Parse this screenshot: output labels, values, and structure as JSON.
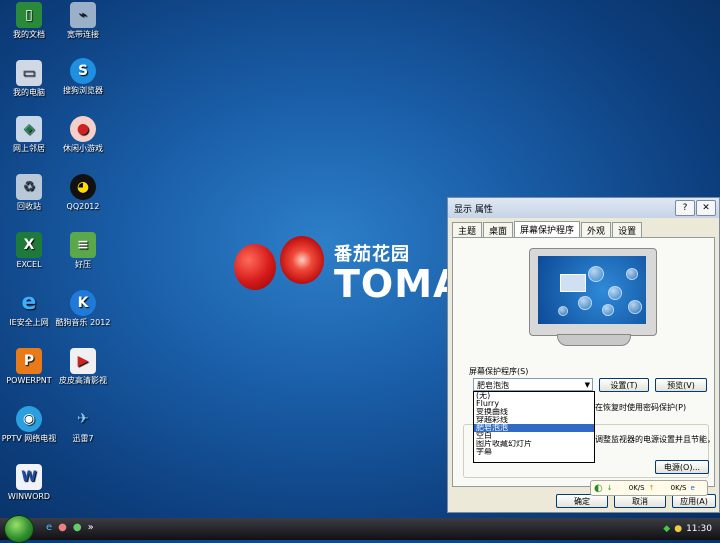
{
  "desktop": {
    "icons": [
      {
        "label": "我的文档",
        "icon": "folder-icon"
      },
      {
        "label": "宽带连接",
        "icon": "network-icon"
      },
      {
        "label": "我的电脑",
        "icon": "computer-icon"
      },
      {
        "label": "搜狗浏览器",
        "icon": "sogou-browser-icon"
      },
      {
        "label": "网上邻居",
        "icon": "network-places-icon"
      },
      {
        "label": "休闲小游戏",
        "icon": "game-icon"
      },
      {
        "label": "回收站",
        "icon": "recycle-bin-icon"
      },
      {
        "label": "QQ2012",
        "icon": "qq-icon"
      },
      {
        "label": "EXCEL",
        "icon": "excel-icon"
      },
      {
        "label": "好压",
        "icon": "haozip-icon"
      },
      {
        "label": "IE安全上网",
        "icon": "ie-icon"
      },
      {
        "label": "酷狗音乐 2012",
        "icon": "kugou-icon"
      },
      {
        "label": "POWERPNT",
        "icon": "powerpoint-icon"
      },
      {
        "label": "皮皮高清影视",
        "icon": "pipi-video-icon"
      },
      {
        "label": "PPTV 网络电视",
        "icon": "pptv-icon"
      },
      {
        "label": "迅雷7",
        "icon": "xunlei-icon"
      },
      {
        "label": "WINWORD",
        "icon": "word-icon"
      }
    ],
    "logo": {
      "cn": "番茄花园",
      "en": "TOMATO"
    }
  },
  "window": {
    "title": "显示 属性",
    "tabs": [
      "主题",
      "桌面",
      "屏幕保护程序",
      "外观",
      "设置"
    ],
    "active_tab": "屏幕保护程序",
    "screensaver_group": "屏幕保护程序(S)",
    "selected": "肥皂泡泡",
    "settings_btn": "设置(T)",
    "preview_btn": "预览(V)",
    "resume_text": "在恢复时使用密码保护(P)",
    "power_text": "调整监视器的电源设置并且节能，请单击\"电",
    "power_btn": "电源(O)...",
    "options": [
      "(无)",
      "Flurry",
      "变换曲线",
      "穿越彩线",
      "肥皂泡泡",
      "空白",
      "图片收藏幻灯片",
      "字幕"
    ],
    "ok_btn": "确定",
    "cancel_btn": "取消",
    "apply_btn": "应用(A)"
  },
  "net_meter": {
    "down": "0K/S",
    "up": "0K/S"
  },
  "taskbar": {
    "quick_launch": "»",
    "clock": "11:30"
  }
}
